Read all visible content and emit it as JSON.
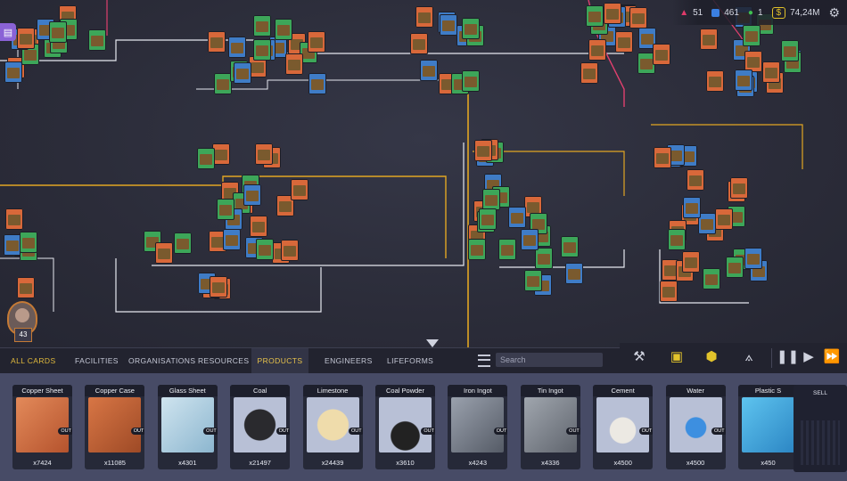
{
  "stats": {
    "vertices": "51",
    "cubes": "461",
    "people": "1",
    "money": "74,24M"
  },
  "tabs": [
    {
      "label": "ALL CARDS"
    },
    {
      "label": "FACILITIES"
    },
    {
      "label": "ORGANISATIONS"
    },
    {
      "label": "RESOURCES"
    },
    {
      "label": "PRODUCTS",
      "active": true
    },
    {
      "label": "ENGINEERS"
    },
    {
      "label": "LIFEFORMS"
    }
  ],
  "search": {
    "placeholder": "Search"
  },
  "player": {
    "level": "43"
  },
  "cards": [
    {
      "name": "Copper Sheet",
      "count": "x7424",
      "out": "OUT"
    },
    {
      "name": "Copper Case",
      "count": "x11085",
      "out": "OUT"
    },
    {
      "name": "Glass Sheet",
      "count": "x4301",
      "out": "OUT"
    },
    {
      "name": "Coal",
      "count": "x21497",
      "out": "OUT"
    },
    {
      "name": "Limestone",
      "count": "x24439",
      "out": "OUT"
    },
    {
      "name": "Coal Powder",
      "count": "x3610",
      "out": "OUT"
    },
    {
      "name": "Iron Ingot",
      "count": "x4243",
      "out": "OUT"
    },
    {
      "name": "Tin Ingot",
      "count": "x4336",
      "out": "OUT"
    },
    {
      "name": "Cement",
      "count": "x4500",
      "out": "OUT"
    },
    {
      "name": "Water",
      "count": "x4500",
      "out": "OUT"
    },
    {
      "name": "Plastic S",
      "count": "x450",
      "out": ""
    }
  ],
  "sell": {
    "label": "SELL"
  },
  "colors": {
    "accent": "#e7c24b",
    "tray": "#474b66",
    "card_green": "#3da659",
    "card_orange": "#d8683a",
    "card_blue": "#3f7cc6",
    "wire_white": "#e6e8f0",
    "wire_yellow": "#e2a623"
  }
}
